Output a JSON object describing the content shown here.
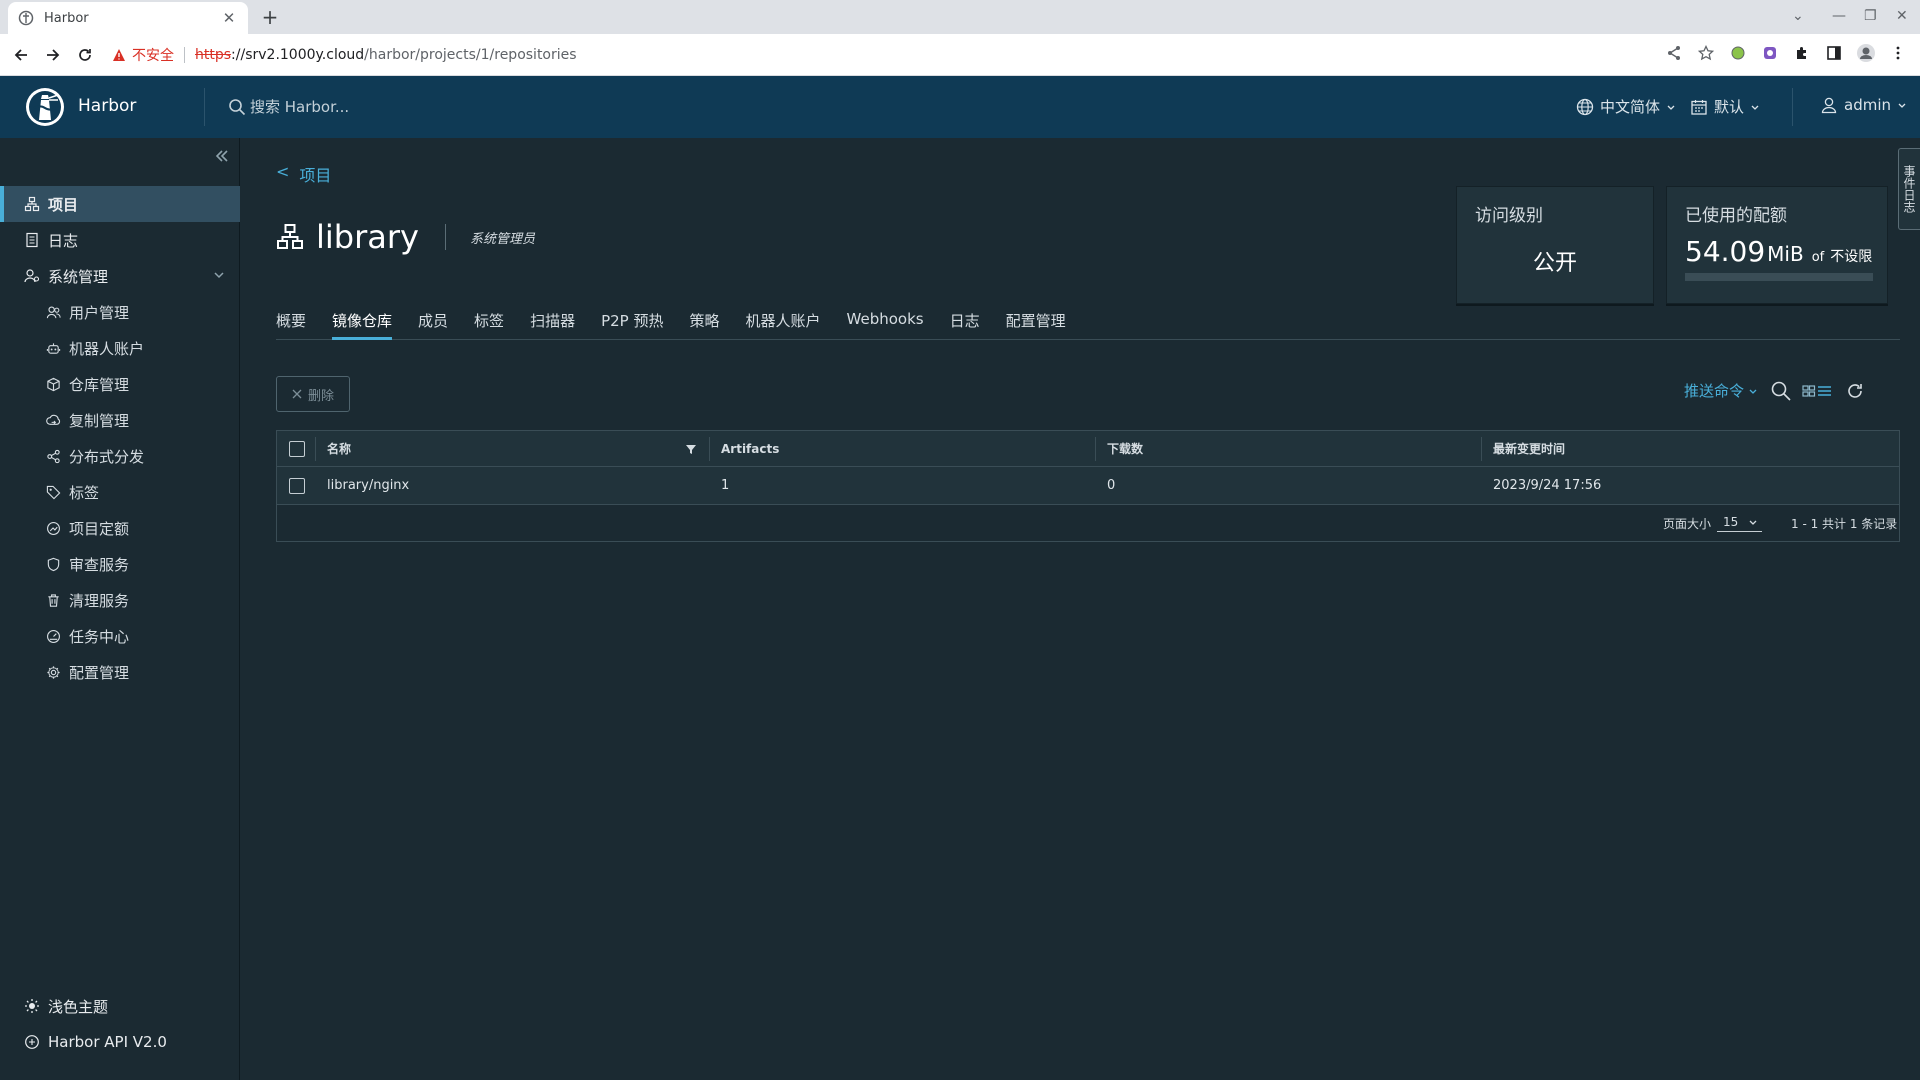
{
  "browser": {
    "tab_title": "Harbor",
    "new_tab": "+",
    "security_warning": "不安全",
    "url_scheme": "https",
    "url_host": "://srv2.1000y.cloud",
    "url_path": "/harbor/projects/1/repositories"
  },
  "header": {
    "brand": "Harbor",
    "search_placeholder": "搜索 Harbor...",
    "language": "中文简体",
    "datetime_format": "默认",
    "user": "admin"
  },
  "sidebar": {
    "items": [
      {
        "label": "项目",
        "icon": "projects-icon"
      },
      {
        "label": "日志",
        "icon": "logs-icon"
      },
      {
        "label": "系统管理",
        "icon": "admin-icon"
      }
    ],
    "sub_items": [
      {
        "label": "用户管理",
        "icon": "users-icon"
      },
      {
        "label": "机器人账户",
        "icon": "robot-icon"
      },
      {
        "label": "仓库管理",
        "icon": "registry-icon"
      },
      {
        "label": "复制管理",
        "icon": "replication-icon"
      },
      {
        "label": "分布式分发",
        "icon": "share-icon"
      },
      {
        "label": "标签",
        "icon": "tag-icon"
      },
      {
        "label": "项目定额",
        "icon": "quota-icon"
      },
      {
        "label": "审查服务",
        "icon": "shield-icon"
      },
      {
        "label": "清理服务",
        "icon": "trash-icon"
      },
      {
        "label": "任务中心",
        "icon": "dashboard-icon"
      },
      {
        "label": "配置管理",
        "icon": "gear-icon"
      }
    ],
    "theme": "浅色主题",
    "api": "Harbor API V2.0"
  },
  "project": {
    "back": "项目",
    "back_arrow": "<",
    "name": "library",
    "role": "系统管理员",
    "access_title": "访问级别",
    "access_value": "公开",
    "quota_title": "已使用的配额",
    "quota_num": "54.09",
    "quota_unit": "MiB",
    "quota_of": "of",
    "quota_limit": "不设限"
  },
  "tabs": [
    "概要",
    "镜像仓库",
    "成员",
    "标签",
    "扫描器",
    "P2P 预热",
    "策略",
    "机器人账户",
    "Webhooks",
    "日志",
    "配置管理"
  ],
  "actions": {
    "delete": "删除",
    "push": "推送命令"
  },
  "table": {
    "columns": [
      "名称",
      "Artifacts",
      "下载数",
      "最新变更时间"
    ],
    "rows": [
      {
        "name": "library/nginx",
        "artifacts": "1",
        "pulls": "0",
        "updated": "2023/9/24 17:56"
      }
    ],
    "page_size_label": "页面大小",
    "page_size": "15",
    "summary": "1 - 1 共计 1 条记录"
  },
  "side_tab": "事件日志",
  "colors": {
    "accent": "#49afd9",
    "header": "#0f3a55",
    "bg": "#1b2a32"
  }
}
